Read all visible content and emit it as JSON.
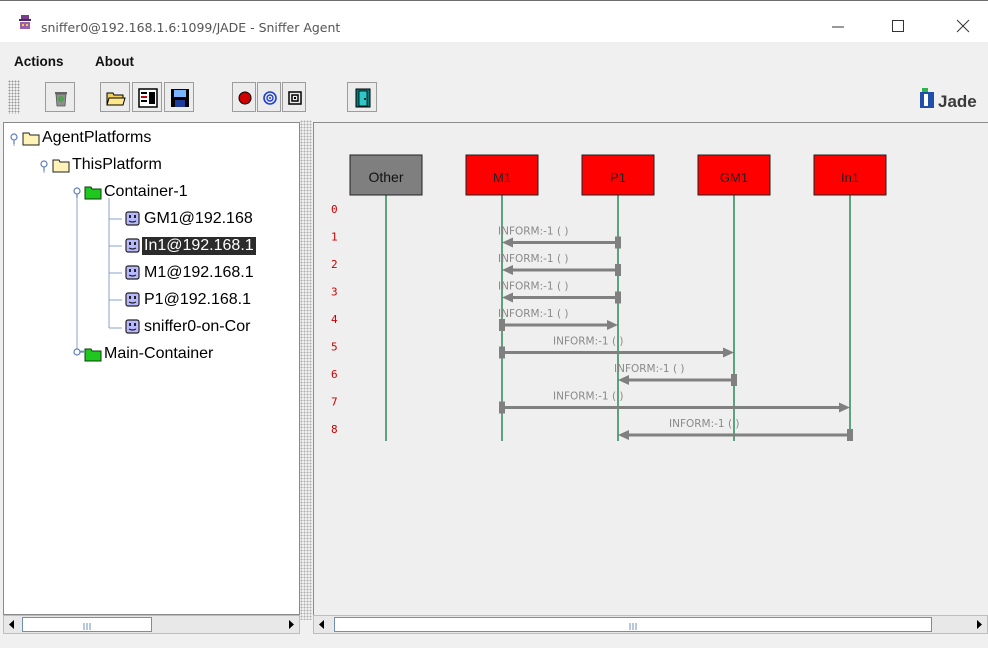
{
  "window": {
    "title": "sniffer0@192.168.1.6:1099/JADE - Sniffer Agent",
    "icon": "sniffer-agent-icon"
  },
  "menu": [
    "Actions",
    "About"
  ],
  "toolbar": {
    "buttons": [
      {
        "name": "clear-canvas-button",
        "icon": "trash-icon"
      },
      {
        "name": "open-snapshot-button",
        "icon": "open-folder-icon"
      },
      {
        "name": "display-log-button",
        "icon": "log-icon"
      },
      {
        "name": "save-snapshot-button",
        "icon": "floppy-icon"
      },
      {
        "name": "do-sniff-button",
        "icon": "record-icon"
      },
      {
        "name": "do-not-sniff-button",
        "icon": "spiral-icon"
      },
      {
        "name": "show-only-button",
        "icon": "filter-icon"
      },
      {
        "name": "exit-button",
        "icon": "exit-door-icon"
      }
    ],
    "logo": "Jade"
  },
  "tree": {
    "root": "AgentPlatforms",
    "platform": "ThisPlatform",
    "container": "Container-1",
    "agents": [
      "GM1@192.168",
      "In1@192.168.1",
      "M1@192.168.1",
      "P1@192.168.1",
      "sniffer0-on-Cor"
    ],
    "selected_index": 1,
    "main_container": "Main-Container"
  },
  "sequence": {
    "agents": [
      {
        "name": "Other",
        "color": "#7f7f7f"
      },
      {
        "name": "M1",
        "color": "#ff0000"
      },
      {
        "name": "P1",
        "color": "#ff0000"
      },
      {
        "name": "GM1",
        "color": "#ff0000"
      },
      {
        "name": "In1",
        "color": "#ff0000"
      }
    ],
    "row_numbers": [
      "0",
      "1",
      "2",
      "3",
      "4",
      "5",
      "6",
      "7",
      "8"
    ],
    "messages": [
      {
        "row": 1,
        "from": "P1",
        "to": "M1",
        "label": "INFORM:-1 (        )"
      },
      {
        "row": 2,
        "from": "P1",
        "to": "M1",
        "label": "INFORM:-1 (        )"
      },
      {
        "row": 3,
        "from": "P1",
        "to": "M1",
        "label": "INFORM:-1 (        )"
      },
      {
        "row": 4,
        "from": "M1",
        "to": "P1",
        "label": "INFORM:-1 (        )"
      },
      {
        "row": 5,
        "from": "M1",
        "to": "GM1",
        "label": "INFORM:-1 (        )"
      },
      {
        "row": 6,
        "from": "GM1",
        "to": "P1",
        "label": "INFORM:-1 (        )"
      },
      {
        "row": 7,
        "from": "M1",
        "to": "In1",
        "label": "INFORM:-1 (        )"
      },
      {
        "row": 8,
        "from": "In1",
        "to": "P1",
        "label": "INFORM:-1 (        )"
      }
    ],
    "lifeline_color": "#0a7a3e",
    "arrow_color": "#808080",
    "row_number_color": "#cc0000"
  }
}
